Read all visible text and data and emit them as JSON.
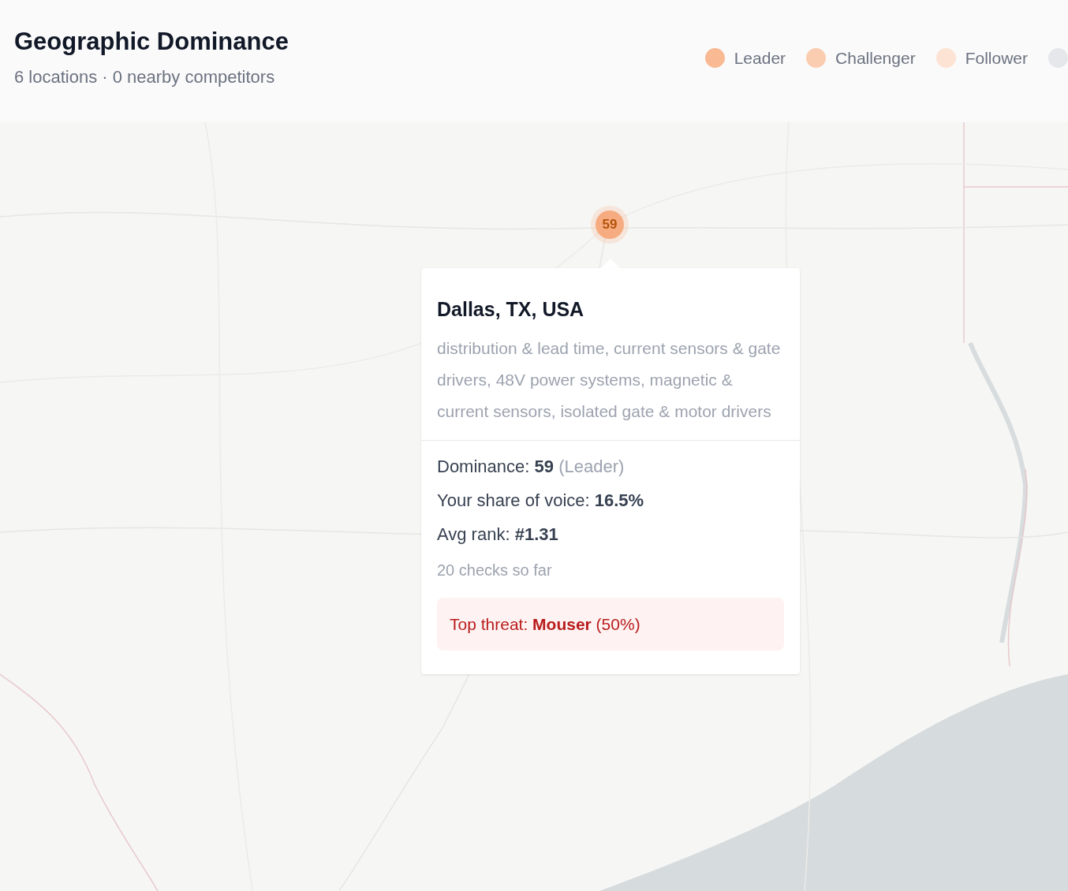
{
  "header": {
    "title": "Geographic Dominance",
    "subtitle": "6 locations · 0 nearby competitors"
  },
  "legend": [
    {
      "label": "Leader",
      "color": "#f8b993"
    },
    {
      "label": "Challenger",
      "color": "#fbcdb0"
    },
    {
      "label": "Follower",
      "color": "#fde3d3"
    },
    {
      "color": "#e5e7eb"
    }
  ],
  "map": {
    "marker": {
      "value": "59",
      "color": "#f6ab80"
    }
  },
  "tooltip": {
    "title": "Dallas, TX, USA",
    "description": "distribution & lead time, current sensors & gate drivers, 48V power systems, magnetic & current sensors, isolated gate & motor drivers",
    "stats": [
      {
        "label": "Dominance:",
        "value": "59",
        "note": "(Leader)"
      },
      {
        "label": "Your share of voice:",
        "value": "16.5%"
      },
      {
        "label": "Avg rank:",
        "value": "#1.31"
      }
    ],
    "checks": "20 checks so far",
    "threat": {
      "label": "Top threat:",
      "name": "Mouser",
      "share": "(50%)"
    }
  }
}
